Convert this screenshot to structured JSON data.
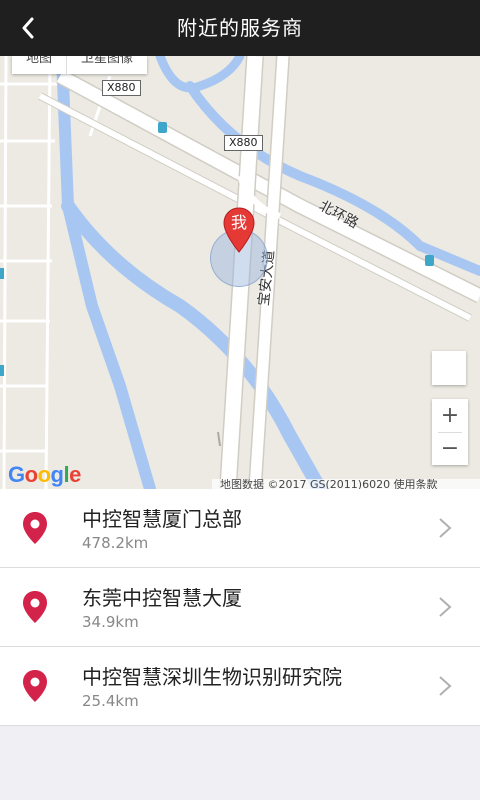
{
  "header": {
    "title": "附近的服务商"
  },
  "map": {
    "map_type": [
      "地图",
      "卫星图像"
    ],
    "road_shields": [
      "X880",
      "X880"
    ],
    "road_labels": [
      "北环路",
      "宝安大道"
    ],
    "me_label": "我",
    "zoom_in": "+",
    "zoom_out": "−",
    "google_logo": "Google",
    "attribution": "地图数据 ©2017 GS(2011)6020   使用条款"
  },
  "providers": [
    {
      "name": "中控智慧厦门总部",
      "distance": "478.2km"
    },
    {
      "name": "东莞中控智慧大厦",
      "distance": "34.9km"
    },
    {
      "name": "中控智慧深圳生物识别研究院",
      "distance": "25.4km"
    }
  ],
  "colors": {
    "header_bg": "#1f1f1f",
    "pin": "#d4234a",
    "water": "#a7c7f2",
    "road": "#ffffff"
  }
}
